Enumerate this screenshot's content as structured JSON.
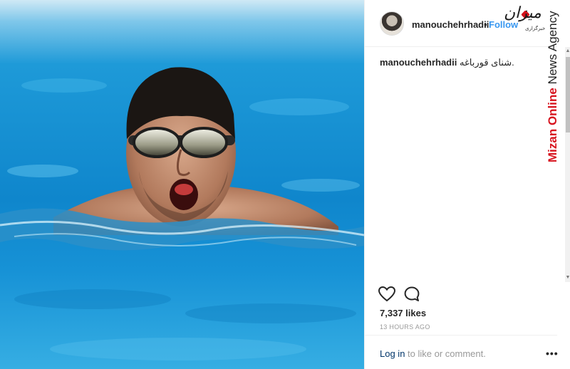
{
  "post": {
    "username": "manouchehrhadii",
    "separator": "•",
    "follow_label": "Follow",
    "caption_user": "manouchehrhadii",
    "caption_text": "شنای قورباغه.",
    "likes": "7,337 likes",
    "timestamp": "13 HOURS AGO",
    "login_link": "Log in",
    "login_suffix": " to like or comment.",
    "more_label": "•••"
  },
  "icons": {
    "like": "heart-icon",
    "comment": "comment-bubble-icon",
    "avatar": "user-avatar"
  },
  "watermark": {
    "brand_red": "Mizan Online",
    "brand_black": " News Agency",
    "logo_text": "میزان",
    "logo_sub": "خبرگزاری"
  },
  "colors": {
    "follow": "#3897f0",
    "link": "#003569",
    "muted": "#999999",
    "brand_red": "#d7141f",
    "pool_blue": "#1592d6"
  },
  "scrollbar": {
    "up_glyph": "▲",
    "down_glyph": "▼"
  }
}
